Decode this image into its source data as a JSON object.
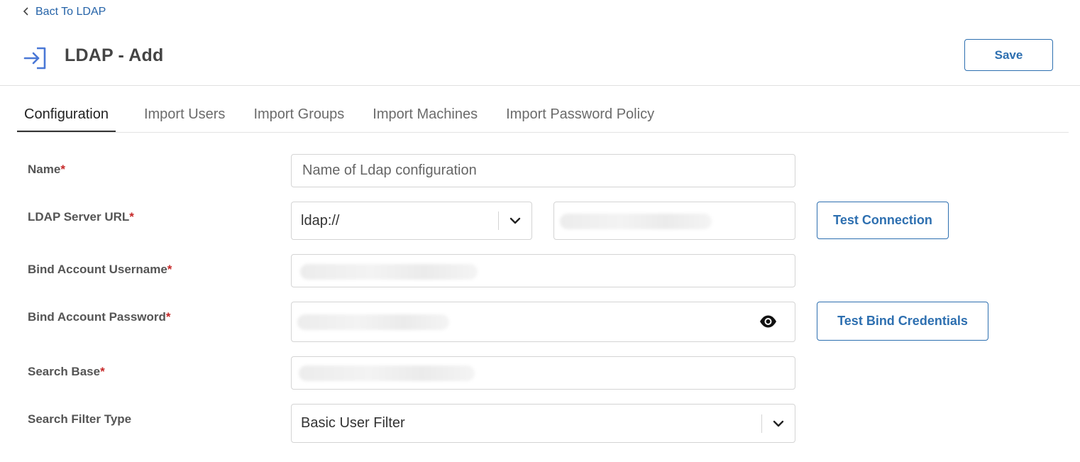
{
  "nav": {
    "back_label": "Bact To LDAP"
  },
  "header": {
    "title": "LDAP - Add",
    "save_label": "Save"
  },
  "tabs": [
    {
      "label": "Configuration",
      "active": true
    },
    {
      "label": "Import Users",
      "active": false
    },
    {
      "label": "Import Groups",
      "active": false
    },
    {
      "label": "Import Machines",
      "active": false
    },
    {
      "label": "Import Password Policy",
      "active": false
    }
  ],
  "form": {
    "name": {
      "label": "Name",
      "required_mark": "*",
      "placeholder": "Name of Ldap configuration"
    },
    "server_url": {
      "label": "LDAP Server URL",
      "required_mark": "*",
      "protocol": "ldap://",
      "test_label": "Test Connection"
    },
    "bind_username": {
      "label": "Bind Account Username",
      "required_mark": "*"
    },
    "bind_password": {
      "label": "Bind Account Password",
      "required_mark": "*",
      "test_label": "Test Bind Credentials"
    },
    "search_base": {
      "label": "Search Base",
      "required_mark": "*"
    },
    "search_filter_type": {
      "label": "Search Filter Type",
      "value": "Basic User Filter"
    }
  },
  "colors": {
    "accent": "#2d6fb0",
    "required": "#c62828",
    "icon": "#4a78d6"
  },
  "icons": {
    "back": "chevron-left-icon",
    "header": "login-icon",
    "dropdown": "chevron-down-icon",
    "password": "eye-icon"
  }
}
